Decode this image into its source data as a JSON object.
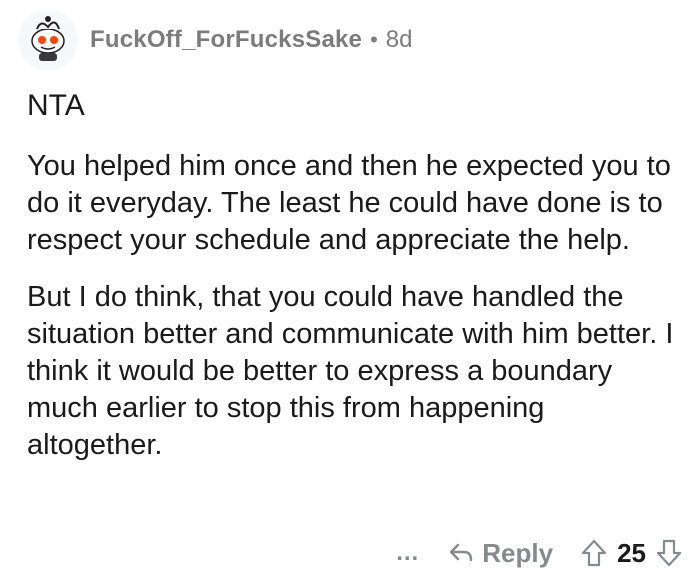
{
  "header": {
    "username": "FuckOff_ForFucksSake",
    "separator": "•",
    "age": "8d",
    "avatar_icon": "reddit-snoo-icon"
  },
  "comment": {
    "verdict": "NTA",
    "paragraphs": [
      "You helped him once and then he expected you to do it everyday. The least he could have done is to respect your schedule and appreciate the help.",
      "But I do think, that you could have handled the situation better and communicate with him better. I think it would be better to express a boundary much earlier to stop this from happening altogether."
    ]
  },
  "actions": {
    "more_label": "…",
    "reply_label": "Reply",
    "vote_count": "25",
    "upvote_icon": "upvote-arrow-icon",
    "downvote_icon": "downvote-arrow-icon",
    "reply_icon": "reply-arrow-icon"
  },
  "colors": {
    "muted": "#7c7c7c",
    "text": "#1a1a1b",
    "icon": "#878a8c"
  }
}
